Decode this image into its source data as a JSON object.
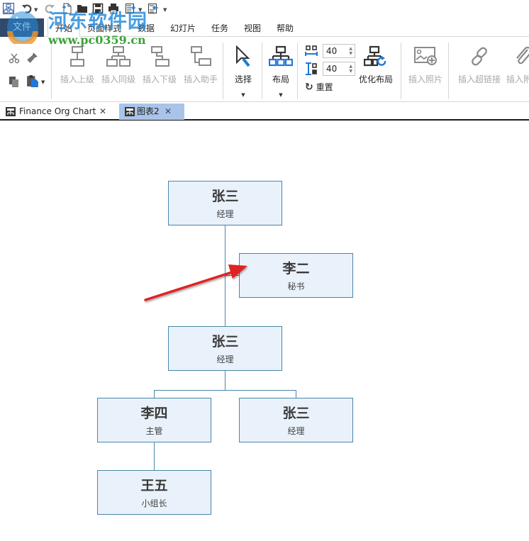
{
  "quick_access": {
    "icons": [
      "app-logo-icon",
      "undo-icon",
      "redo-icon",
      "new-file-icon",
      "open-folder-icon",
      "save-icon",
      "print-icon",
      "export-icon",
      "import-icon",
      "customize-icon"
    ]
  },
  "menu": {
    "file": "文件",
    "tabs": [
      "开始",
      "页面样式",
      "数据",
      "幻灯片",
      "任务",
      "视图",
      "帮助"
    ],
    "active": "开始"
  },
  "ribbon": {
    "clipboard": [
      "cut-icon",
      "format-painter-icon",
      "copy-icon",
      "paste-icon"
    ],
    "insert_buttons": [
      {
        "label": "插入上级",
        "icon": "insert-superior-icon"
      },
      {
        "label": "插入同级",
        "icon": "insert-sibling-icon"
      },
      {
        "label": "插入下级",
        "icon": "insert-subordinate-icon"
      },
      {
        "label": "插入助手",
        "icon": "insert-assistant-icon"
      }
    ],
    "select_label": "选择",
    "layout_label": "布局",
    "spacing_h": "40",
    "spacing_v": "40",
    "reset_label": "重置",
    "optimize_label": "优化布局",
    "insert_photo_label": "插入照片",
    "insert_link_label": "插入超链接",
    "insert_attach_label": "插入附"
  },
  "doc_tabs": [
    {
      "label": "Finance Org Chart",
      "active": false
    },
    {
      "label": "图表2",
      "active": true
    }
  ],
  "org_chart": {
    "nodes": [
      {
        "id": "n1",
        "name": "张三",
        "role": "经理"
      },
      {
        "id": "n2",
        "name": "李二",
        "role": "秘书"
      },
      {
        "id": "n3",
        "name": "张三",
        "role": "经理"
      },
      {
        "id": "n4",
        "name": "李四",
        "role": "主管"
      },
      {
        "id": "n5",
        "name": "张三",
        "role": "经理"
      },
      {
        "id": "n6",
        "name": "王五",
        "role": "小组长"
      }
    ]
  },
  "watermark": {
    "title": "河东软件园",
    "url": "www.pc0359.cn"
  },
  "colors": {
    "node_fill": "#e9f1fa",
    "node_border": "#4a86aa",
    "active_doc_tab": "#a9c4e8",
    "file_menu": "#2f4a6b",
    "accent_blue": "#1e78d7",
    "annotation_arrow": "#e02020"
  }
}
